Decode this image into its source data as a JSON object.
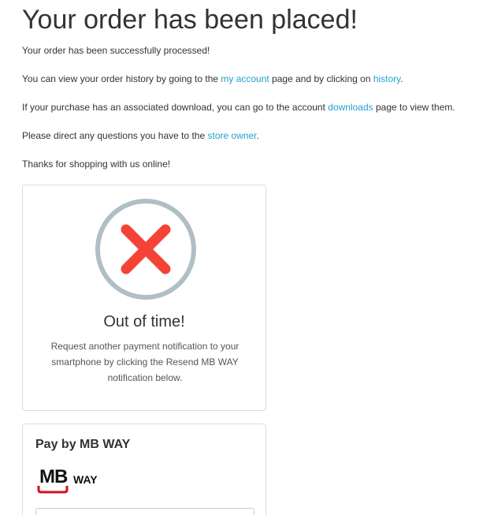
{
  "page": {
    "title": "Your order has been placed!"
  },
  "content": {
    "p1": "Your order has been successfully processed!",
    "p2_before": "You can view your order history by going to the ",
    "p2_link1": "my account",
    "p2_middle": " page and by clicking on ",
    "p2_link2": "history",
    "p2_after": ".",
    "p3_before": "If your purchase has an associated download, you can go to the account ",
    "p3_link": "downloads",
    "p3_after": " page to view them.",
    "p4_before": "Please direct any questions you have to the ",
    "p4_link": "store owner",
    "p4_after": ".",
    "p5": "Thanks for shopping with us online!"
  },
  "status_card": {
    "icon": "error-x-circle-icon",
    "heading": "Out of time!",
    "message": "Request another payment notification to your smartphone by clicking the Resend MB WAY notification below."
  },
  "payment": {
    "title": "Pay by MB WAY",
    "logo_mb": "MB",
    "logo_way": "WAY",
    "logo_icon": "mb-way-logo-icon"
  },
  "colors": {
    "link": "#23a1d1",
    "error_x": "#f44336",
    "circle_ring": "#b0bec5",
    "mb_red": "#d40f1f"
  }
}
